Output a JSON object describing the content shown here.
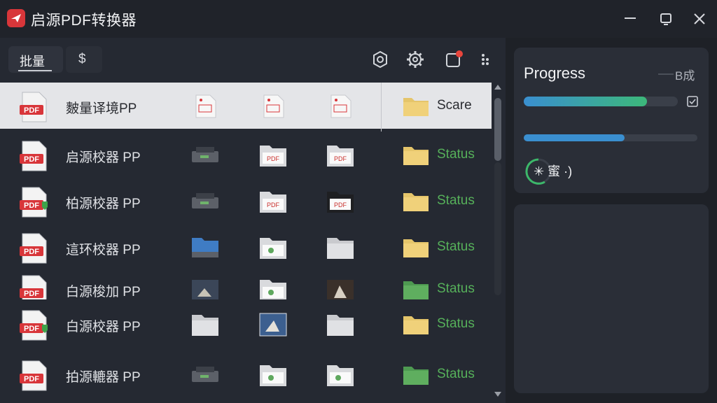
{
  "window": {
    "title": "启源PDF转换器",
    "controls": [
      "minimize-icon",
      "maximize-icon",
      "close-icon"
    ]
  },
  "tabs": [
    {
      "label": "批量",
      "active": true
    },
    {
      "label": "$",
      "active": false
    }
  ],
  "toolbar": {
    "icons": [
      "settings-icon",
      "gear-icon",
      "notification-window-icon",
      "more-vertical-icon"
    ],
    "notification_dot_color": "#e8453c"
  },
  "rows": [
    {
      "name": "麬量译境PP",
      "status": "Scare",
      "selected": true,
      "thumbs": [
        "pdf-doc-icon",
        "pdf-doc-icon",
        "pdf-doc-icon"
      ],
      "folder_color": "#e5c56a"
    },
    {
      "name": "启源校器 PP",
      "status": "Status",
      "selected": false,
      "thumbs": [
        "printer-icon",
        "pdf-folder-icon",
        "pdf-folder-icon"
      ],
      "folder_color": "#e5c56a"
    },
    {
      "name": "柏源校器 PP",
      "status": "Status",
      "selected": false,
      "thumbs": [
        "printer-icon",
        "pdf-folder-icon",
        "pdf-folder-icon"
      ],
      "folder_color": "#e5c56a"
    },
    {
      "name": "這环校器 PP",
      "status": "Status",
      "selected": false,
      "thumbs": [
        "blue-folder-icon",
        "green-folder-icon",
        "grey-folder-icon"
      ],
      "folder_color": "#e5c56a"
    },
    {
      "name": "白源梭加 PP",
      "status": "Status",
      "selected": false,
      "thumbs": [
        "image-thumb-icon",
        "green-folder-icon",
        "image-thumb-icon"
      ],
      "folder_color": "#5fa85e"
    },
    {
      "name": "白源校器 PP",
      "status": "Status",
      "selected": false,
      "thumbs": [
        "grey-folder-icon",
        "image-thumb-icon",
        "grey-folder-icon"
      ],
      "folder_color": "#e5c56a"
    },
    {
      "name": "拍源轆器 PP",
      "status": "Status",
      "selected": false,
      "thumbs": [
        "printer-icon",
        "green-folder-icon",
        "green-folder-icon"
      ],
      "folder_color": "#5fa85e"
    }
  ],
  "progress": {
    "title": "Progress",
    "done_label": "B成",
    "bar1_fraction": 0.8,
    "bar2_fraction": 0.58,
    "spinner_text": "✳ 蜜 ·)"
  }
}
